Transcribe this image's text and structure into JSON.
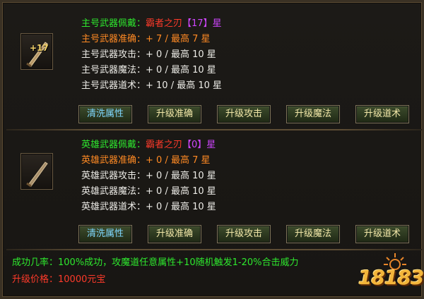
{
  "main": {
    "slot_level": "+17",
    "lines": [
      {
        "label": "主号武器佩戴：",
        "value": "霸者之刃",
        "tag": "【17】星"
      },
      {
        "label": "主号武器准确：",
        "value": "+ 7 / 最高 7   星"
      },
      {
        "label": "主号武器攻击：",
        "value": "+ 0 / 最高 10 星"
      },
      {
        "label": "主号武器魔法：",
        "value": "+ 0 / 最高 10 星"
      },
      {
        "label": "主号武器道术：",
        "value": "+ 10 / 最高 10 星"
      }
    ],
    "buttons": [
      "清洗属性",
      "升级准确",
      "升级攻击",
      "升级魔法",
      "升级道术"
    ]
  },
  "hero": {
    "lines": [
      {
        "label": "英雄武器佩戴：",
        "value": "霸者之刃",
        "tag": "【0】星"
      },
      {
        "label": "英雄武器准确：",
        "value": "+ 0 / 最高 7   星"
      },
      {
        "label": "英雄武器攻击：",
        "value": "+ 0 / 最高 10 星"
      },
      {
        "label": "英雄武器魔法：",
        "value": "+ 0 / 最高 10 星"
      },
      {
        "label": "英雄武器道术：",
        "value": "+ 0 / 最高 10 星"
      }
    ],
    "buttons": [
      "清洗属性",
      "升级准确",
      "升级攻击",
      "升级魔法",
      "升级道术"
    ]
  },
  "footer": {
    "success_label": "成功几率：",
    "success_value": "100%成功，攻魔道任意属性+10随机触发1-20%合击威力",
    "price_label": "升级价格：",
    "price_value": "10000元宝"
  },
  "logo": {
    "text": "18183"
  },
  "colors": {
    "green": "#2ee82e",
    "orange": "#ff8a24",
    "red": "#ff3a2a",
    "purple": "#cf46ff",
    "white": "#ecebe6",
    "button_text": "#f2e7a8",
    "button_blue": "#7fd8ff"
  }
}
